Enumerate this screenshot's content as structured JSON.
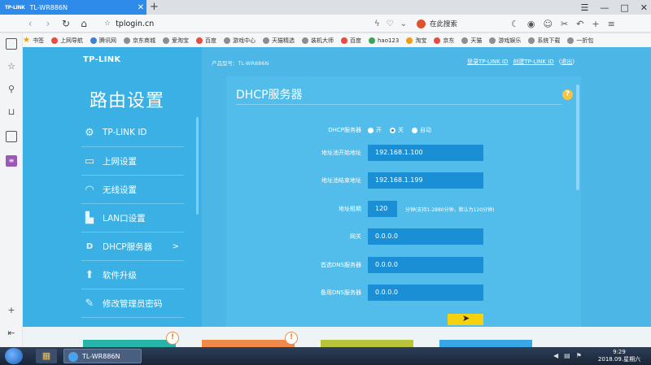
{
  "browser": {
    "tab_title": "TL-WR886N",
    "tab_logo": "TP-LINK",
    "new_tab": "+",
    "window_controls": [
      "☰",
      "—",
      "□",
      "✕"
    ],
    "address": "tplogin.cn",
    "search_placeholder": "在此搜索",
    "bookmarks": [
      "书签",
      "上网导航",
      "腾讯网",
      "京东商城",
      "爱淘宝",
      "百度",
      "游戏中心",
      "天猫精选",
      "装机大师",
      "百度",
      "hao123",
      "淘宝",
      "京东",
      "天猫",
      "游戏娱乐",
      "系统下载",
      "一折包"
    ]
  },
  "router": {
    "logo": "TP-LINK",
    "sidebar_title": "路由设置",
    "model_label": "产品型号：TL-WR886N",
    "link_login": "登录TP-LINK ID",
    "link_create": "创建TP-LINK ID",
    "link_logout": "退出",
    "menu": [
      {
        "label": "TP-LINK ID",
        "icon": "gear-icon",
        "glyph": "⚙"
      },
      {
        "label": "上网设置",
        "icon": "laptop-icon",
        "glyph": "▭"
      },
      {
        "label": "无线设置",
        "icon": "wifi-icon",
        "glyph": "◠"
      },
      {
        "label": "LAN口设置",
        "icon": "lan-icon",
        "glyph": "▙"
      },
      {
        "label": "DHCP服务器",
        "icon": "dhcp-icon",
        "glyph": "D",
        "arrow": ">"
      },
      {
        "label": "软件升级",
        "icon": "upgrade-arrow-icon",
        "glyph": "⬆"
      },
      {
        "label": "修改管理员密码",
        "icon": "pencil-icon",
        "glyph": "✎"
      }
    ],
    "panel": {
      "title": "DHCP服务器",
      "help": "?",
      "dhcp_label": "DHCP服务器",
      "radio_options": [
        "开",
        "关",
        "自动"
      ],
      "radio_selected": "关",
      "start_label": "地址池开始地址",
      "start_value": "192.168.1.100",
      "end_label": "地址池结束地址",
      "end_value": "192.168.1.199",
      "lease_label": "地址租期",
      "lease_value": "120",
      "lease_hint": "分钟(支持1-2880分钟，默认为120分钟)",
      "gateway_label": "网关",
      "gateway_value": "0.0.0.0",
      "dns1_label": "首选DNS服务器",
      "dns1_value": "0.0.0.0",
      "dns2_label": "备用DNS服务器",
      "dns2_value": "0.0.0.0"
    },
    "bottom_badges": [
      "!",
      "!"
    ]
  },
  "taskbar": {
    "app_title": "TL-WR886N",
    "time": "9:29",
    "date": "2018.09.星期六"
  },
  "colors": {
    "sidebar": "#3ab0e4",
    "panel": "#52bdea",
    "field": "#1b8fd6",
    "accent": "#2e8bea"
  }
}
